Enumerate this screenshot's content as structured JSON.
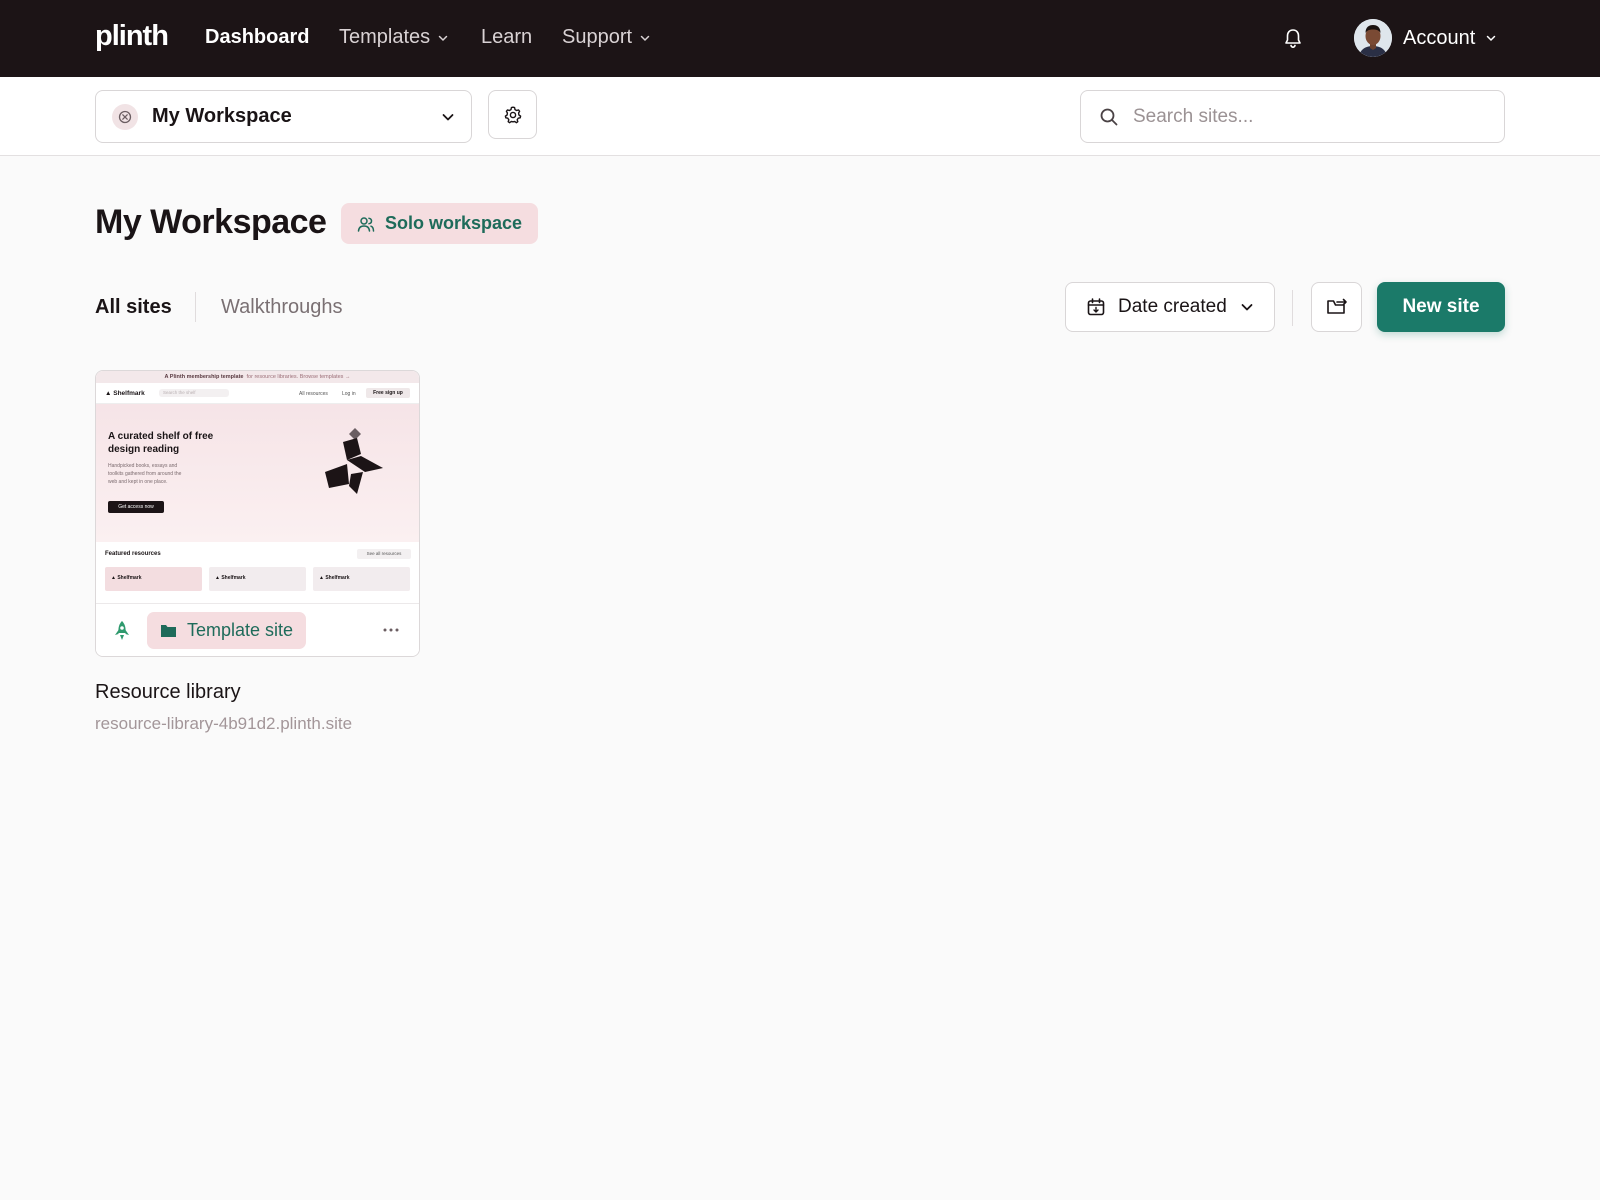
{
  "topnav": {
    "logo": "plinth",
    "items": [
      {
        "label": "Dashboard",
        "active": true,
        "dropdown": false
      },
      {
        "label": "Templates",
        "active": false,
        "dropdown": true
      },
      {
        "label": "Learn",
        "active": false,
        "dropdown": false
      },
      {
        "label": "Support",
        "active": false,
        "dropdown": true
      }
    ],
    "account_label": "Account"
  },
  "subbar": {
    "workspace_label": "My Workspace",
    "search_placeholder": "Search sites..."
  },
  "header": {
    "title": "My Workspace",
    "badge": "Solo workspace"
  },
  "tabs": [
    {
      "label": "All sites",
      "active": true
    },
    {
      "label": "Walkthroughs",
      "active": false
    }
  ],
  "toolbar": {
    "sort_label": "Date created",
    "new_site_label": "New site"
  },
  "sites": [
    {
      "name": "Resource library",
      "url": "resource-library-4b91d2.plinth.site",
      "badge": "Template site",
      "thumbnail": {
        "banner_bold": "A Plinth membership template",
        "banner_rest": "for resource libraries. Browse templates →",
        "brand": "Shelfmark",
        "search_placeholder": "Search the shelf",
        "nav_links": [
          "All resources",
          "Log in"
        ],
        "signup": "Free sign up",
        "headline": "A curated shelf of free design reading",
        "subtext": "Handpicked books, essays and toolkits gathered from around the web and kept in one place.",
        "cta": "Get access now",
        "featured_title": "Featured resources",
        "see_all": "See all resources",
        "mini_cards": [
          "Shelfmark",
          "Shelfmark",
          "Shelfmark"
        ]
      }
    }
  ],
  "colors": {
    "nav_bg": "#1c1416",
    "accent": "#1b7a69",
    "badge_bg": "#f5dde0",
    "badge_text": "#1e6b5a",
    "page_bg": "#fafafa"
  },
  "icons": {
    "bell": "bell-icon",
    "gear": "gear-icon",
    "search": "search-icon",
    "calendar": "calendar-icon",
    "folder_move": "folder-move-icon",
    "rocket": "rocket-icon",
    "folder": "folder-icon",
    "more": "more-horizontal-icon",
    "users": "users-icon"
  }
}
